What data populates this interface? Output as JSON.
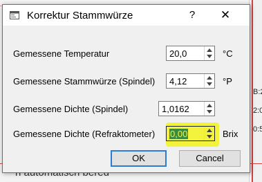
{
  "background": {
    "side_fragments": [
      "B:2",
      "2:0",
      "0:5"
    ],
    "bottom_text": "n automatisch bered"
  },
  "dialog": {
    "title": "Korrektur Stammwürze",
    "help_label": "?",
    "close_label": "✕",
    "fields": [
      {
        "label": "Gemessene Temperatur",
        "value": "20,0",
        "unit": "°C"
      },
      {
        "label": "Gemessene Stammwürze (Spindel)",
        "value": "4,12",
        "unit": "°P"
      },
      {
        "label": "Gemessene Dichte (Spindel)",
        "value": "1,0162",
        "unit": ""
      },
      {
        "label": "Gemessene Dichte (Refraktometer)",
        "value": "0,00",
        "unit": "Brix"
      }
    ],
    "ok_label": "OK",
    "cancel_label": "Cancel"
  },
  "colors": {
    "highlight": "#f3f33d",
    "focus_border": "#2a7bd4",
    "selection": "#3c8a3c"
  }
}
